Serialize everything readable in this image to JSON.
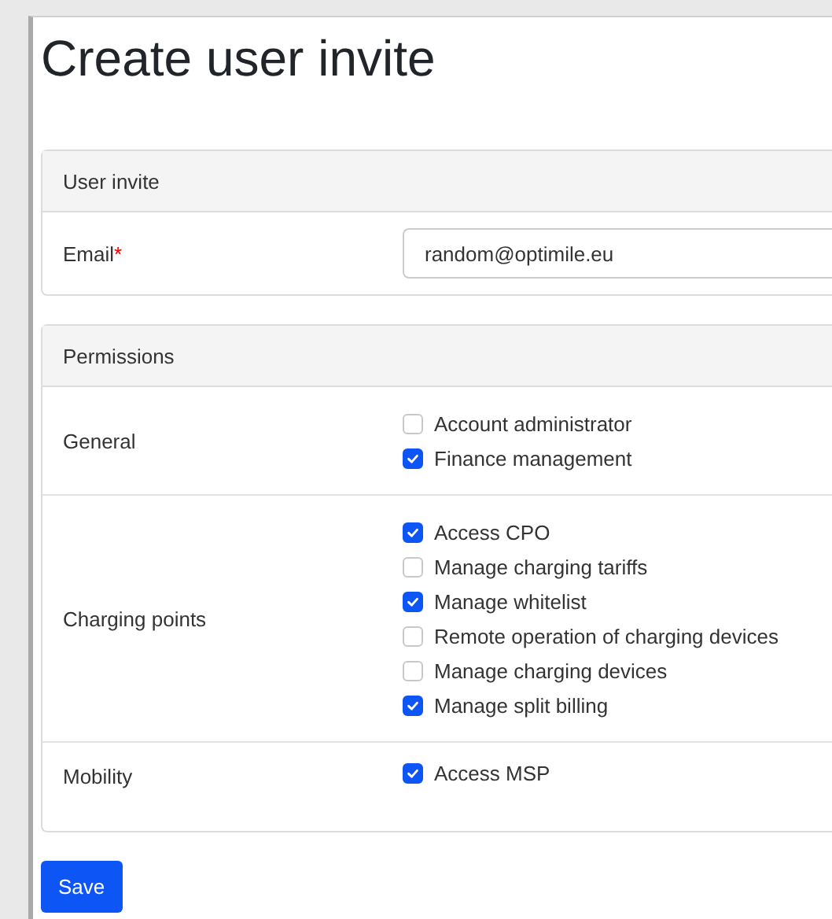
{
  "title": "Create user invite",
  "user_invite": {
    "header": "User invite",
    "email": {
      "label": "Email",
      "required_mark": "*",
      "value": "random@optimile.eu"
    }
  },
  "permissions": {
    "header": "Permissions",
    "groups": [
      {
        "label": "General",
        "options": [
          {
            "label": "Account administrator",
            "checked": false
          },
          {
            "label": "Finance management",
            "checked": true
          }
        ]
      },
      {
        "label": "Charging points",
        "options": [
          {
            "label": "Access CPO",
            "checked": true
          },
          {
            "label": "Manage charging tariffs",
            "checked": false
          },
          {
            "label": "Manage whitelist",
            "checked": true
          },
          {
            "label": "Remote operation of charging devices",
            "checked": false
          },
          {
            "label": "Manage charging devices",
            "checked": false
          },
          {
            "label": "Manage split billing",
            "checked": true
          }
        ]
      },
      {
        "label": "Mobility",
        "options": [
          {
            "label": "Access MSP",
            "checked": true
          }
        ]
      }
    ]
  },
  "save_button": "Save"
}
